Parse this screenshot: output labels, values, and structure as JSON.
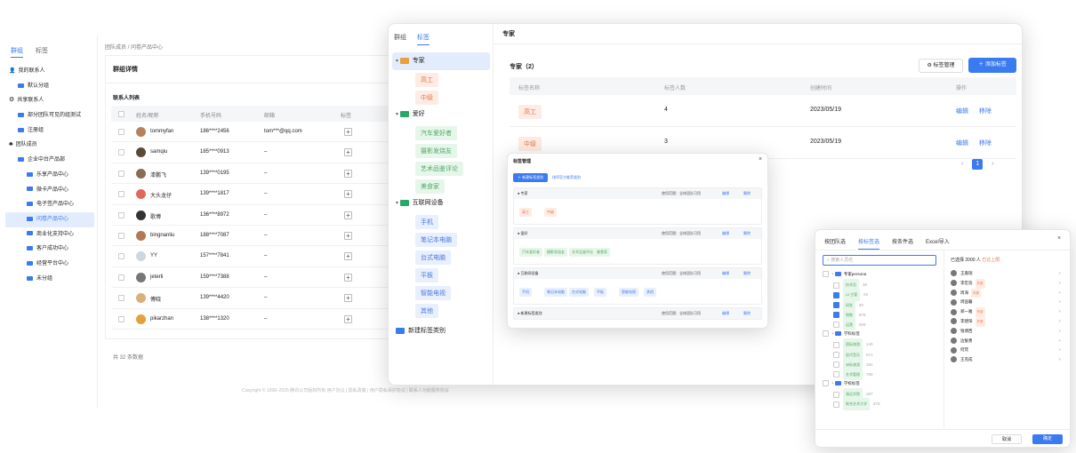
{
  "w1": {
    "tabs": [
      "群组",
      "标签"
    ],
    "breadcrumb": "团队成员 / 问卷产品中心",
    "title": "群组详情",
    "list_title": "联系人列表",
    "cols": [
      "姓名/昵称",
      "手机号码",
      "邮箱",
      "标签"
    ],
    "sidebar": [
      {
        "label": "我的联系人",
        "lvl": 0,
        "icon": "person"
      },
      {
        "label": "默认分组",
        "lvl": 1,
        "icon": "folder"
      },
      {
        "label": "共享联系人",
        "lvl": 0,
        "icon": "share"
      },
      {
        "label": "部分团队可见的组测试",
        "lvl": 1,
        "icon": "folder"
      },
      {
        "label": "注册组",
        "lvl": 1,
        "icon": "folder"
      },
      {
        "label": "团队成员",
        "lvl": 0,
        "icon": "team"
      },
      {
        "label": "企业中台产品部",
        "lvl": 1,
        "icon": "folder"
      },
      {
        "label": "乐享产品中心",
        "lvl": 2,
        "icon": "folder"
      },
      {
        "label": "微卡产品中心",
        "lvl": 2,
        "icon": "folder"
      },
      {
        "label": "电子签产品中心",
        "lvl": 2,
        "icon": "folder"
      },
      {
        "label": "问卷产品中心",
        "lvl": 2,
        "icon": "folder",
        "active": true
      },
      {
        "label": "商业化支持中心",
        "lvl": 2,
        "icon": "folder"
      },
      {
        "label": "客户成功中心",
        "lvl": 2,
        "icon": "folder"
      },
      {
        "label": "经营平台中心",
        "lvl": 2,
        "icon": "folder"
      },
      {
        "label": "未分组",
        "lvl": 2,
        "icon": "folder"
      }
    ],
    "rows": [
      {
        "name": "tommyfan",
        "phone": "186****2456",
        "email": "tom***@qq.com",
        "c": "#b4835a"
      },
      {
        "name": "samqiu",
        "phone": "185****0913",
        "email": "–",
        "c": "#5a4a3a"
      },
      {
        "name": "漆鹏飞",
        "phone": "139****0195",
        "email": "–",
        "c": "#8a6b55"
      },
      {
        "name": "大头龙仔",
        "phone": "139****1817",
        "email": "–",
        "c": "#e06a5a"
      },
      {
        "name": "歌博",
        "phone": "136****8972",
        "email": "–",
        "c": "#333"
      },
      {
        "name": "bingnanliu",
        "phone": "188****7087",
        "email": "–",
        "c": "#b07a55"
      },
      {
        "name": "YY",
        "phone": "157****7841",
        "email": "–",
        "c": "#cfd6df"
      },
      {
        "name": "jeterli",
        "phone": "159****7388",
        "email": "–",
        "c": "#777"
      },
      {
        "name": "傅晓",
        "phone": "139****4420",
        "email": "–",
        "c": "#d8b07a"
      },
      {
        "name": "pikarzhan",
        "phone": "138****1320",
        "email": "–",
        "c": "#e2a23a"
      }
    ],
    "total": "共 32 条数据",
    "footer": "Copyright © 1998–2025 腾讯公司版权所有  用户协议 | 隐私政策 | 用户隐私保护协议 | 联系人功能服务协议"
  },
  "w2": {
    "tabs": [
      "群组",
      "标签"
    ],
    "tree": [
      {
        "type": "cat",
        "label": "专家",
        "active": true
      },
      {
        "type": "tag",
        "label": "高工",
        "cls": "tag-orange"
      },
      {
        "type": "tag",
        "label": "中级",
        "cls": "tag-orange"
      },
      {
        "type": "cat",
        "label": "爱好"
      },
      {
        "type": "tag",
        "label": "汽车爱好者",
        "cls": "tag-green"
      },
      {
        "type": "tag",
        "label": "摄影发烧友",
        "cls": "tag-green"
      },
      {
        "type": "tag",
        "label": "艺术品鉴评论",
        "cls": "tag-green"
      },
      {
        "type": "tag",
        "label": "美食家",
        "cls": "tag-green"
      },
      {
        "type": "cat",
        "label": "互联网设备"
      },
      {
        "type": "tag",
        "label": "手机",
        "cls": "tag-blue"
      },
      {
        "type": "tag",
        "label": "笔记本电脑",
        "cls": "tag-blue"
      },
      {
        "type": "tag",
        "label": "台式电脑",
        "cls": "tag-blue"
      },
      {
        "type": "tag",
        "label": "平板",
        "cls": "tag-blue"
      },
      {
        "type": "tag",
        "label": "智能电视",
        "cls": "tag-blue"
      },
      {
        "type": "tag",
        "label": "其他",
        "cls": "tag-blue"
      },
      {
        "type": "new",
        "label": "新建标签类别"
      }
    ],
    "header": "专家",
    "section": "专家（2）",
    "btn_manage": "标签管理",
    "btn_add": "＋ 添加标签",
    "cols": [
      "标签名称",
      "标签人数",
      "创建时间",
      "操作"
    ],
    "rows": [
      {
        "name": "高工",
        "count": "4",
        "date": "2023/05/19"
      },
      {
        "name": "中级",
        "count": "3",
        "date": "2023/05/19"
      }
    ],
    "edit": "编辑",
    "remove": "移除",
    "page": "1"
  },
  "w3": {
    "title": "标签管理",
    "btn_new": "＋ 新建标签类别",
    "btn_rule": "排序官方推荐类别",
    "groups": [
      {
        "name": "● 专家",
        "tags": [
          "高工",
          "中级"
        ],
        "cls": "tag-orange"
      },
      {
        "name": "● 爱好",
        "tags": [
          "汽车爱好者",
          "摄影发烧友",
          "艺术品鉴评论",
          "美食家"
        ],
        "cls": "tag-green"
      },
      {
        "name": "● 互联网设备",
        "tags": [
          "手机",
          "笔记本电脑",
          "台式电脑",
          "平板",
          "智能电视",
          "其他"
        ],
        "cls": "tag-blue"
      },
      {
        "name": "● 新建标签类别",
        "tags": [],
        "cls": ""
      }
    ],
    "range": "使用范围：全体团队可用",
    "edit": "编辑",
    "del": "删除"
  },
  "w4": {
    "tabs": [
      "按团队选",
      "按标签选",
      "按条件选",
      "Excel导入"
    ],
    "search": "搜索人员名",
    "selected": "已选择 2000 人",
    "limit": "已达上限",
    "tree": [
      {
        "type": "cat",
        "label": "专家persona"
      },
      {
        "type": "t",
        "label": "技术员",
        "n": "36",
        "on": false
      },
      {
        "type": "t",
        "label": "UI 主管",
        "n": "92",
        "on": true
      },
      {
        "type": "t",
        "label": "研发",
        "n": "80",
        "on": true
      },
      {
        "type": "t",
        "label": "销售",
        "n": "879",
        "on": true
      },
      {
        "type": "t",
        "label": "运营",
        "n": "909",
        "on": false
      },
      {
        "type": "cat",
        "label": "学科标签"
      },
      {
        "type": "t",
        "label": "国际旅游",
        "n": "140",
        "on": false
      },
      {
        "type": "t",
        "label": "现代音乐",
        "n": "071",
        "on": false
      },
      {
        "type": "t",
        "label": "洲际旅游",
        "n": "292",
        "on": false
      },
      {
        "type": "t",
        "label": "艺术管理",
        "n": "780",
        "on": false
      },
      {
        "type": "cat",
        "label": "学校标签"
      },
      {
        "type": "t",
        "label": "清远学院",
        "n": "287",
        "on": false
      },
      {
        "type": "t",
        "label": "联合艺术大学",
        "n": "678",
        "on": false
      }
    ],
    "people": [
      {
        "name": "王嘉瑞",
        "tag": ""
      },
      {
        "name": "李宏浩",
        "tag": "外部"
      },
      {
        "name": "周海",
        "tag": "外部"
      },
      {
        "name": "周国暮",
        "tag": ""
      },
      {
        "name": "郑一雅",
        "tag": "外部"
      },
      {
        "name": "李建阳",
        "tag": "外部"
      },
      {
        "name": "钱博西",
        "tag": ""
      },
      {
        "name": "边誓勇",
        "tag": ""
      },
      {
        "name": "何梵",
        "tag": ""
      },
      {
        "name": "王克成",
        "tag": ""
      }
    ],
    "cancel": "取消",
    "ok": "确定"
  }
}
